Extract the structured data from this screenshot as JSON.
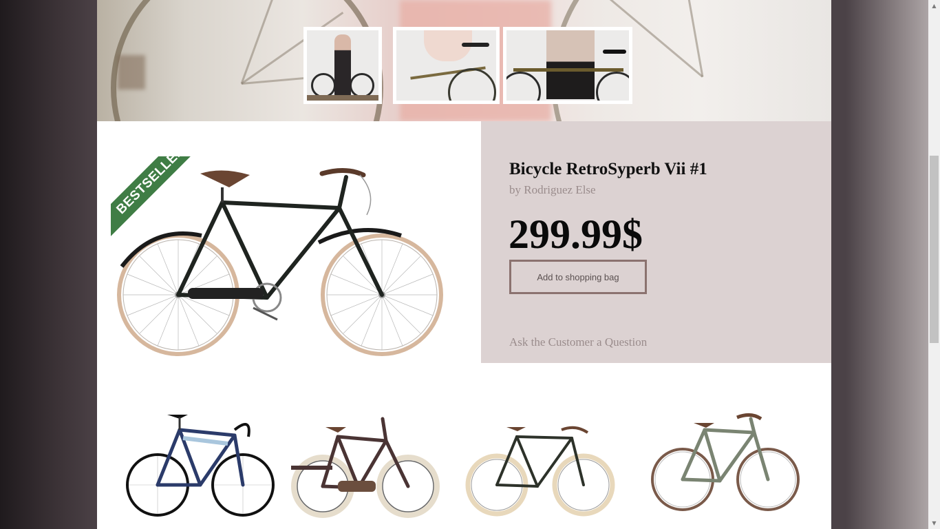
{
  "product": {
    "badge": "BESTSELLER",
    "title": "Bicycle RetroSyperb Vii #1",
    "author": "by Rodriguez Else",
    "price": "299.99$",
    "add_to_bag_label": "Add to shopping bag",
    "ask_question_label": "Ask the Customer a Question"
  },
  "gallery": {
    "thumbnails": [
      {
        "name": "gallery-thumbnail-1"
      },
      {
        "name": "gallery-thumbnail-2"
      },
      {
        "name": "gallery-thumbnail-3"
      }
    ]
  },
  "related_products": [
    {
      "name": "road-bike",
      "frame_color": "#2b3b6a"
    },
    {
      "name": "brown-city-bike",
      "frame_color": "#4a3434"
    },
    {
      "name": "black-retro-bike",
      "frame_color": "#2d322a"
    },
    {
      "name": "green-city-bike",
      "frame_color": "#7a8472"
    }
  ],
  "colors": {
    "accent_green": "#3f7d45",
    "info_panel": "#dcd2d2",
    "button_border": "#8b726f",
    "muted_text": "#9a8c8c"
  },
  "scrollbar": {
    "up_icon": "scroll-up-arrow-icon",
    "down_icon": "scroll-down-arrow-icon"
  }
}
